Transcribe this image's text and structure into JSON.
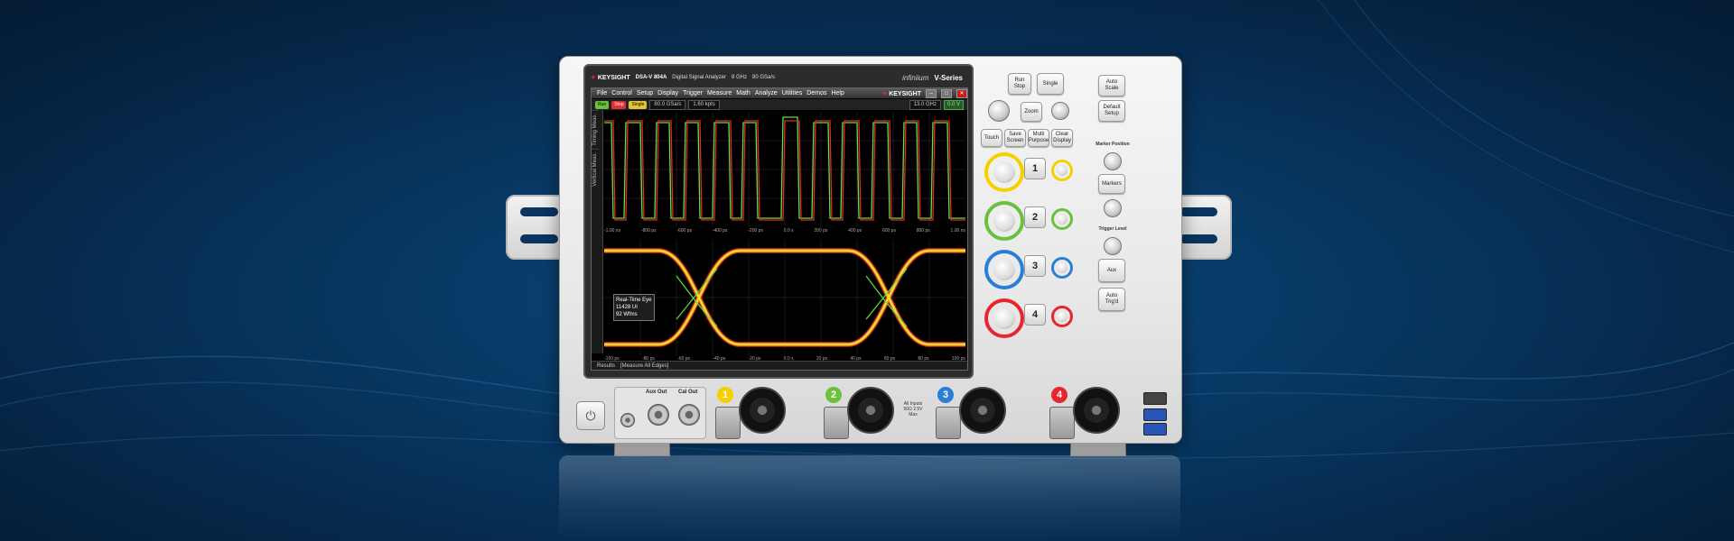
{
  "header": {
    "brand": "KEYSIGHT",
    "model": "DSA-V 804A",
    "model_sub": "Digital Signal Analyzer",
    "spec1": "8 GHz",
    "spec2": "80 GSa/s",
    "family": "infiniium",
    "series": "V-Series"
  },
  "menu": {
    "items": [
      "File",
      "Control",
      "Setup",
      "Display",
      "Trigger",
      "Measure",
      "Math",
      "Analyze",
      "Utilities",
      "Demos",
      "Help"
    ],
    "brand": "KEYSIGHT"
  },
  "toolbar": {
    "run": "Run",
    "stop": "Stop",
    "single": "Single",
    "sample_rate": "80.0 GSa/s",
    "memory": "1.60 kpts",
    "bandwidth": "13.0 GHz",
    "trig_level": "0.0 V"
  },
  "side_tabs": [
    "Timing Meas.",
    "Vertical Meas."
  ],
  "top_plot": {
    "x_ticks": [
      "-1.00 ns",
      "-800 ps",
      "-600 ps",
      "-400 ps",
      "-200 ps",
      "0.0 s",
      "200 ps",
      "400 ps",
      "600 ps",
      "800 ps",
      "1.00 ns"
    ]
  },
  "bottom_plot": {
    "x_ticks": [
      "-100 ps",
      "-80 ps",
      "-60 ps",
      "-40 ps",
      "-20 ps",
      "0.0 s",
      "20 ps",
      "40 ps",
      "60 ps",
      "80 ps",
      "100 ps"
    ],
    "eye_info": {
      "title": "Real-Time Eye",
      "ui": "11428 UI",
      "wfms": "92 Wfms"
    }
  },
  "status": {
    "results": "Results",
    "measure_all": "[Measure All Edges]"
  },
  "panel": {
    "run_stop": "Run\nStop",
    "single": "Single",
    "auto_scale": "Auto\nScale",
    "default_setup": "Default\nSetup",
    "zoom": "Zoom",
    "touch": "Touch",
    "save_screen": "Save\nScreen",
    "multi_purpose": "Multi\nPurpose",
    "clear_display": "Clear\nDisplay",
    "marker_position": "Marker Position",
    "markers": "Markers",
    "trigger_level": "Trigger Level",
    "aux": "Aux",
    "auto_trig": "Auto\nTrig'd",
    "channels": [
      "1",
      "2",
      "3",
      "4"
    ],
    "channel_colors": [
      "#f5d000",
      "#6ac13e",
      "#2a7fd4",
      "#e5262f"
    ]
  },
  "front": {
    "aux_out": "Aux Out",
    "cal_out": "Cal Out",
    "warning": "All Inputs 50Ω 2.5V Max"
  }
}
